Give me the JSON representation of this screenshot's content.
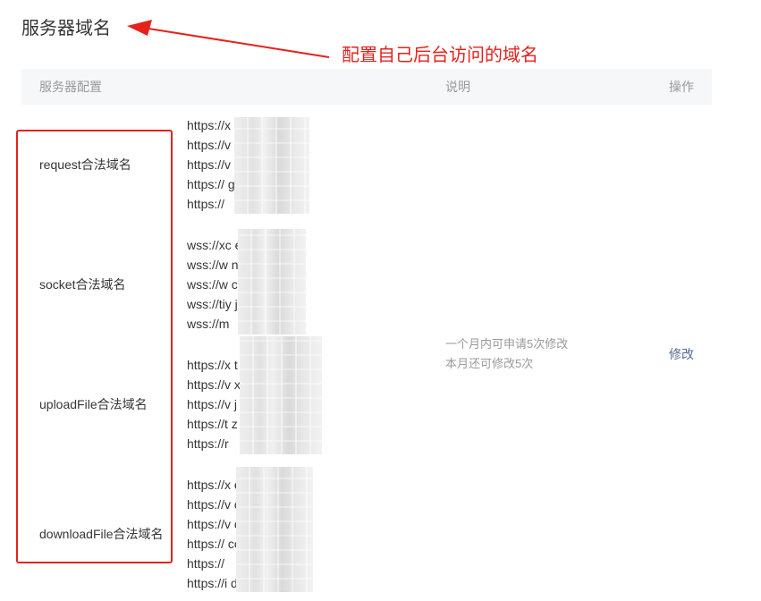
{
  "page": {
    "title": "服务器域名"
  },
  "annotation": {
    "text": "配置自己后台访问的域名"
  },
  "table": {
    "headers": {
      "config": "服务器配置",
      "description": "说明",
      "operation": "操作"
    },
    "rows": [
      {
        "label": "request合法域名",
        "domains": [
          "https://x            e.me",
          "https://v             .cn",
          "https://v               g.com",
          "https://               g.com",
          "https://"
        ]
      },
      {
        "label": "socket合法域名",
        "domains": [
          "wss://xc            e.me",
          "wss://w             n",
          "wss://w               com",
          "wss://tiy      j        com",
          "wss://m"
        ]
      },
      {
        "label": "uploadFile合法域名",
        "domains": [
          "https://x      t        me",
          "https://v      x        n",
          "https://v      j        com",
          "https://t      z        g.com",
          "https://r"
        ]
      },
      {
        "label": "downloadFile合法域名",
        "domains": [
          "https://x            e.me",
          "https://v             cn",
          "https://v               com",
          "https://               com",
          "https://               ",
          "https://i         d."
        ]
      }
    ],
    "description": {
      "line1": "一个月内可申请5次修改",
      "line2": "本月还可修改5次"
    },
    "operation_label": "修改"
  },
  "colors": {
    "annotation": "#e5221c",
    "link": "#576b95",
    "header_bg": "#f6f7f9",
    "muted_text": "#9a9a9a"
  }
}
